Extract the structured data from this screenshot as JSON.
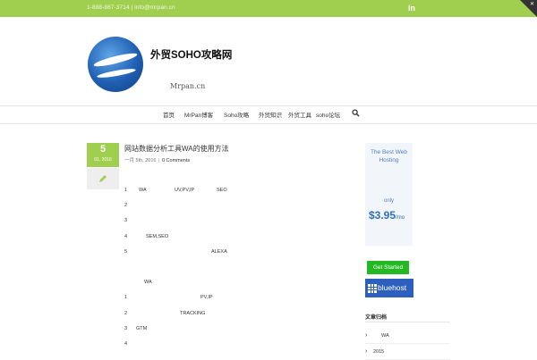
{
  "topbar": {
    "contact": "1-888-867-3714 | info@mrpan.cn",
    "linkedin_label": "in"
  },
  "logo": {
    "title": "外贸SOHO攻略网",
    "subtitle": "Mrpan.cn"
  },
  "nav": {
    "items": [
      {
        "label": "首页",
        "active": true
      },
      {
        "label": "MrPan博客",
        "active": false
      },
      {
        "label": "Soho攻略",
        "active": true
      },
      {
        "label": "外贸知识",
        "active": false
      },
      {
        "label": "外贸工具",
        "active": false
      },
      {
        "label": "soho论坛",
        "active": false
      }
    ]
  },
  "post": {
    "day": "5",
    "month_year": "01, 2016",
    "title": "网站数据分析工具WA的使用方法",
    "meta_date": "一月 5th, 2016",
    "meta_sep": "|",
    "meta_comments": "0 Comments",
    "lines": [
      {
        "num": "1",
        "a": "WA",
        "b": "UV,PV,IP",
        "c": "SEO"
      },
      {
        "num": "2",
        "a": "",
        "b": "",
        "c": ""
      },
      {
        "num": "3",
        "a": "",
        "b": "",
        "c": ""
      },
      {
        "num": "4",
        "a": "SEM,SEO",
        "b": "",
        "c": ""
      },
      {
        "num": "5",
        "a": "",
        "b": "",
        "c": "ALEXA"
      },
      {
        "num": "",
        "a": "WA",
        "b": "",
        "c": ""
      },
      {
        "num": "1",
        "a": "",
        "b": "PV,IP",
        "c": ""
      },
      {
        "num": "2",
        "a": "",
        "b": "TRACKING",
        "c": ""
      },
      {
        "num": "3",
        "a": "GTM",
        "b": "",
        "c": ""
      },
      {
        "num": "4",
        "a": "",
        "b": "",
        "c": ""
      }
    ]
  },
  "sidebar": {
    "ad": {
      "title": "The Best Web Hosting",
      "only": "only",
      "price": "$3.95",
      "per": "/mo",
      "button": "Get Started",
      "brand": "bluehost"
    },
    "widget_title": "文章归档",
    "widget_items": [
      {
        "label": "WA"
      },
      {
        "label": "2015"
      }
    ]
  },
  "icons": {
    "search": "search-icon",
    "linkedin": "linkedin-icon",
    "pencil": "pencil-icon",
    "chevron": "chevron-right-icon"
  },
  "colors": {
    "accent": "#a0ce4e",
    "ad_blue": "#2f6fbf",
    "button_green": "#23b923"
  }
}
